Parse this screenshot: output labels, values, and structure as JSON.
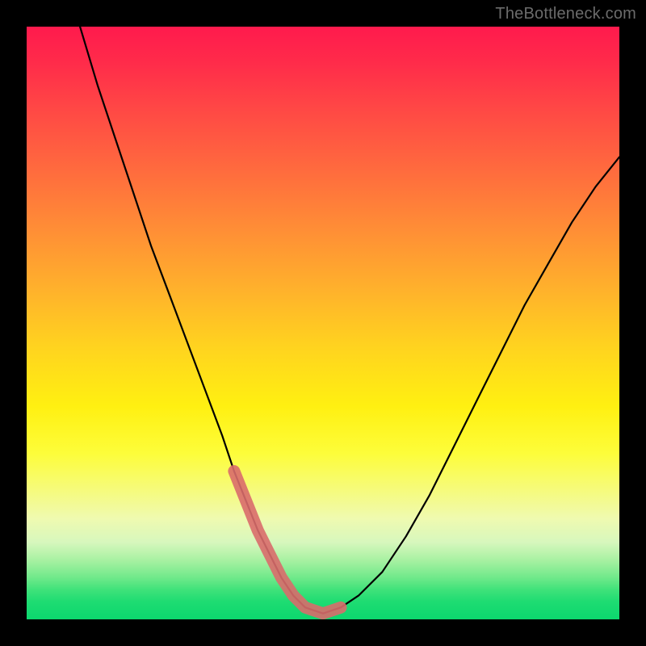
{
  "watermark": "TheBottleneck.com",
  "chart_data": {
    "type": "line",
    "title": "",
    "xlabel": "",
    "ylabel": "",
    "xlim": [
      0,
      100
    ],
    "ylim": [
      0,
      100
    ],
    "series": [
      {
        "name": "bottleneck-curve",
        "x": [
          9,
          12,
          15,
          18,
          21,
          24,
          27,
          30,
          33,
          35,
          37,
          39,
          41,
          43,
          45,
          47,
          50,
          53,
          56,
          60,
          64,
          68,
          72,
          76,
          80,
          84,
          88,
          92,
          96,
          100
        ],
        "values": [
          100,
          90,
          81,
          72,
          63,
          55,
          47,
          39,
          31,
          25,
          20,
          15,
          11,
          7,
          4,
          2,
          1,
          2,
          4,
          8,
          14,
          21,
          29,
          37,
          45,
          53,
          60,
          67,
          73,
          78
        ]
      },
      {
        "name": "highlight-segment",
        "x": [
          35,
          37,
          39,
          41,
          43,
          45,
          47,
          50,
          53
        ],
        "values": [
          25,
          20,
          15,
          11,
          7,
          4,
          2,
          1,
          2
        ]
      }
    ],
    "colors": {
      "curve": "#000000",
      "highlight": "#d96b6b"
    }
  }
}
